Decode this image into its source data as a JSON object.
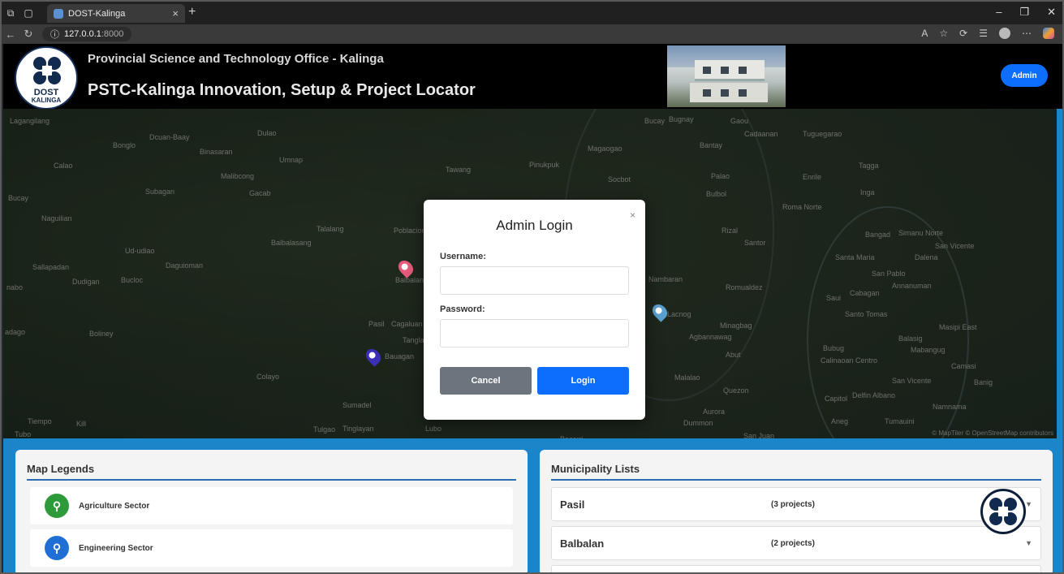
{
  "browser": {
    "tab_title": "DOST-Kalinga",
    "url_host": "127.0.0.1",
    "url_port": ":8000"
  },
  "header": {
    "logo_line1": "DOST",
    "logo_line2": "KALINGA",
    "subtitle": "Provincial Science and Technology Office - Kalinga",
    "title": "PSTC-Kalinga Innovation, Setup & Project Locator",
    "admin_button": "Admin"
  },
  "map": {
    "labels": [
      "Lagangilang",
      "Bonglo",
      "Dcuan-Baay",
      "Dulao",
      "Binasaran",
      "Umnap",
      "Calao",
      "Malibcong",
      "Subagan",
      "Gacab",
      "Bucay",
      "Naguilian",
      "Talalang",
      "Poblacion",
      "Balbalasang",
      "Ud-udiao",
      "Sallapadan",
      "Daguioman",
      "Dudigan",
      "Bucloc",
      "nabo",
      "Balbalan",
      "Pasil",
      "Cagaluan",
      "Tanglag",
      "adago",
      "Boliney",
      "Bauagan",
      "Colayo",
      "Sumadel",
      "Tiempo",
      "Kill",
      "Tubo",
      "Tulgao",
      "Tinglayan",
      "Lubo",
      "Bacarri",
      "Bucay",
      "Bugnay",
      "Gaou",
      "Magaogao",
      "Tawang",
      "Pinukpuk",
      "Bantay",
      "Cadaanan",
      "Tuguegarao",
      "Socbot",
      "Palao",
      "Enrile",
      "Tagga",
      "Bulbol",
      "Inga",
      "Roma Norte",
      "Rizal",
      "Santor",
      "Bangad",
      "Simanu Norte",
      "San Vicente",
      "Santa Maria",
      "Dalena",
      "Nambaran",
      "Romualdez",
      "San Pablo",
      "Annanuman",
      "Saui",
      "Cabagan",
      "Lacnog",
      "Minagbag",
      "Santo Tomas",
      "Agbannawag",
      "Masipi East",
      "Balasig",
      "Abut",
      "Mabangug",
      "Bubug",
      "Calinaoan Centro",
      "Camasi",
      "Malalao",
      "San Vicente",
      "Banig",
      "Quezon",
      "Capitol",
      "Delfin Albano",
      "Namnama",
      "Aurora",
      "Dummon",
      "Aneg",
      "Tumauini",
      "San Juan"
    ],
    "attribution": "© MapTiler © OpenStreetMap contributors",
    "pin_colors": {
      "agriculture": "#e55a7a",
      "engineering": "#5aa0d0",
      "other": "#3b2fb5"
    }
  },
  "legend": {
    "title": "Map Legends",
    "items": [
      {
        "label": "Agriculture Sector",
        "color": "#2e9b3a"
      },
      {
        "label": "Engineering Sector",
        "color": "#1f6fd6"
      }
    ]
  },
  "municipalities": {
    "title": "Municipality Lists",
    "items": [
      {
        "name": "Pasil",
        "count": "(3 projects)"
      },
      {
        "name": "Balbalan",
        "count": "(2 projects)"
      }
    ]
  },
  "modal": {
    "title": "Admin Login",
    "close": "×",
    "username_label": "Username:",
    "password_label": "Password:",
    "cancel": "Cancel",
    "login": "Login"
  }
}
